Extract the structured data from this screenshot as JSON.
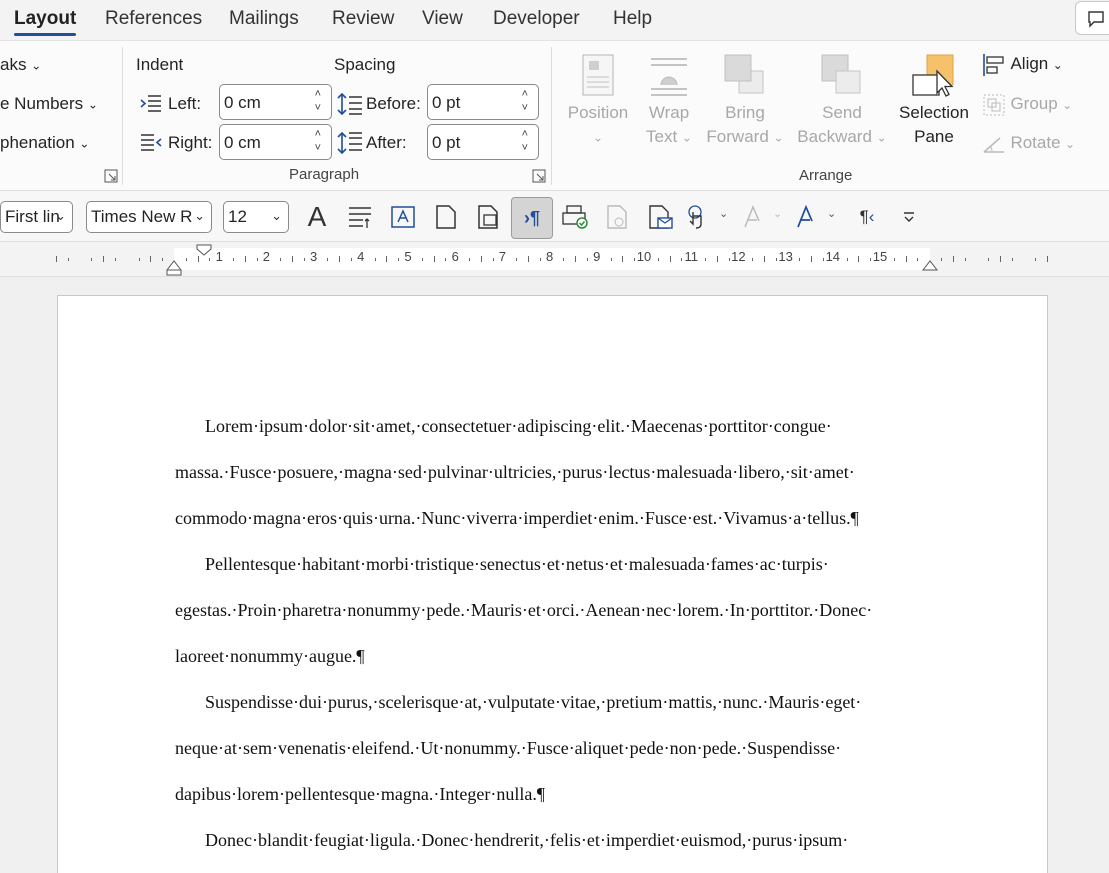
{
  "tabs": [
    "Layout",
    "References",
    "Mailings",
    "Review",
    "View",
    "Developer",
    "Help"
  ],
  "active_tab": "Layout",
  "page_setup_partial": {
    "breaks": "aks",
    "line_numbers": "e Numbers",
    "hyphenation": "phenation"
  },
  "paragraph": {
    "group_label": "Paragraph",
    "indent_heading": "Indent",
    "spacing_heading": "Spacing",
    "left_label": "Left:",
    "right_label": "Right:",
    "left_value": "0 cm",
    "right_value": "0 cm",
    "before_label": "Before:",
    "after_label": "After:",
    "before_value": "0 pt",
    "after_value": "0 pt"
  },
  "arrange": {
    "group_label": "Arrange",
    "position": "Position",
    "wrap_text_1": "Wrap",
    "wrap_text_2": "Text",
    "bring_forward_1": "Bring",
    "bring_forward_2": "Forward",
    "send_backward_1": "Send",
    "send_backward_2": "Backward",
    "selection_pane_1": "Selection",
    "selection_pane_2": "Pane",
    "align": "Align",
    "group": "Group",
    "rotate": "Rotate"
  },
  "toolbar": {
    "style_value": "First lin",
    "font_value": "Times New R",
    "size_value": "12"
  },
  "ruler_numbers": [
    "1",
    "2",
    "3",
    "4",
    "5",
    "6",
    "7",
    "8",
    "9",
    "10",
    "11",
    "12",
    "13",
    "14",
    "15"
  ],
  "document": {
    "paragraphs": [
      "Lorem·ipsum·dolor·sit·amet,·consectetuer·adipiscing·elit.·Maecenas·porttitor·congue· massa.·Fusce·posuere,·magna·sed·pulvinar·ultricies,·purus·lectus·malesuada·libero,·sit·amet· commodo·magna·eros·quis·urna.·Nunc·viverra·imperdiet·enim.·Fusce·est.·Vivamus·a·tellus.¶",
      "Pellentesque·habitant·morbi·tristique·senectus·et·netus·et·malesuada·fames·ac·turpis· egestas.·Proin·pharetra·nonummy·pede.·Mauris·et·orci.·Aenean·nec·lorem.·In·porttitor.·Donec· laoreet·nonummy·augue.¶",
      "Suspendisse·dui·purus,·scelerisque·at,·vulputate·vitae,·pretium·mattis,·nunc.·Mauris·eget· neque·at·sem·venenatis·eleifend.·Ut·nonummy.·Fusce·aliquet·pede·non·pede.·Suspendisse· dapibus·lorem·pellentesque·magna.·Integer·nulla.¶",
      "Donec·blandit·feugiat·ligula.·Donec·hendrerit,·felis·et·imperdiet·euismod,·purus·ipsum·"
    ]
  },
  "colors": {
    "accent": "#1f4e9c",
    "selection_pane_icon": "#f5c26b"
  }
}
